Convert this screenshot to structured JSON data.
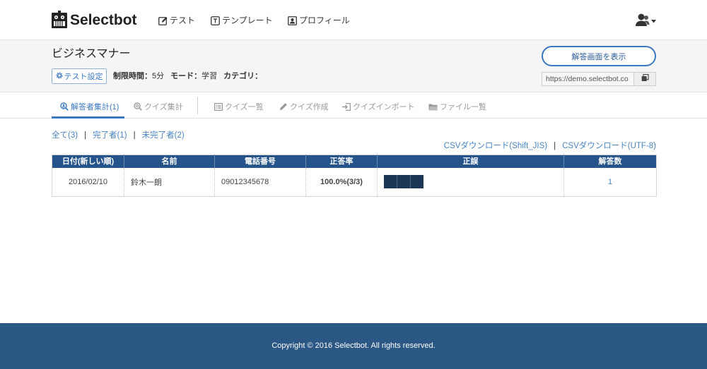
{
  "colors": {
    "accent": "#3a78c2",
    "link": "#4a84c4",
    "table_header": "#24548a",
    "footer": "#2b5784",
    "correct_mark": "#1d3658",
    "rate": "#2f9a4e"
  },
  "header": {
    "logo_text": "Selectbot",
    "logo_icon": "robot-logo-icon",
    "nav": [
      {
        "label": "テスト",
        "icon": "edit-icon"
      },
      {
        "label": "テンプレート",
        "icon": "template-icon"
      },
      {
        "label": "プロフィール",
        "icon": "profile-icon"
      }
    ],
    "user_menu_icon": "user-icon"
  },
  "test": {
    "title": "ビジネスマナー",
    "settings_label": "テスト設定",
    "settings_icon": "gear-icon",
    "meta": [
      {
        "label": "制限時間：",
        "value": "5分"
      },
      {
        "label": "モード：",
        "value": "学習"
      },
      {
        "label": "カテゴリ："
      }
    ],
    "show_answer_label": "解答画面を表示",
    "answer_url": "https://demo.selectbot.co",
    "copy_icon": "copy-icon"
  },
  "tabs": [
    {
      "label": "解答者集計(1)",
      "icon": "user-search-icon",
      "active": true
    },
    {
      "label": "クイズ集計",
      "icon": "search-icon",
      "active": false
    },
    {
      "label": "クイズ一覧",
      "icon": "list-icon",
      "active": false
    },
    {
      "label": "クイズ作成",
      "icon": "pencil-icon",
      "active": false
    },
    {
      "label": "クイズインポート",
      "icon": "import-icon",
      "active": false
    },
    {
      "label": "ファイル一覧",
      "icon": "folder-icon",
      "active": false
    }
  ],
  "filters": {
    "separator": "|",
    "items": [
      {
        "label": "全て(3)"
      },
      {
        "label": "完了者(1)"
      },
      {
        "label": "未完了者(2)"
      }
    ]
  },
  "csv": {
    "separator": "|",
    "links": [
      {
        "label": "CSVダウンロード(Shift_JIS)"
      },
      {
        "label": "CSVダウンロード(UTF-8)"
      }
    ]
  },
  "table": {
    "columns": [
      "日付(新しい順)",
      "名前",
      "電話番号",
      "正答率",
      "正誤",
      "解答数"
    ],
    "rows": [
      {
        "date": "2016/02/10",
        "name": "鈴木一朗",
        "phone": "09012345678",
        "rate": "100.0%(3/3)",
        "results": [
          true,
          true,
          true
        ],
        "answer_count": "1"
      }
    ]
  },
  "footer": {
    "copyright": "Copyright © 2016 Selectbot. All rights reserved."
  }
}
